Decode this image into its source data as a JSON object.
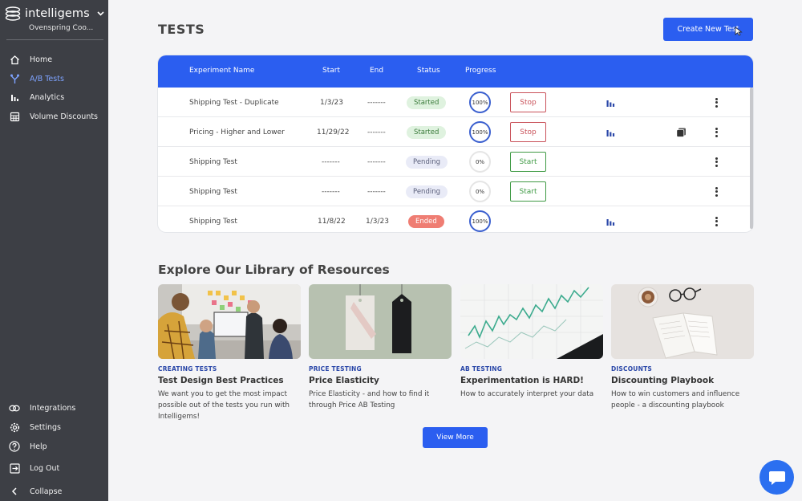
{
  "sidebar": {
    "brand": "intelligems",
    "store": "Ovenspring Coo...",
    "top_items": [
      {
        "label": "Home",
        "icon": "home-icon"
      },
      {
        "label": "A/B Tests",
        "icon": "fork-icon",
        "active": true
      },
      {
        "label": "Analytics",
        "icon": "bar-chart-icon"
      },
      {
        "label": "Volume Discounts",
        "icon": "calculator-icon"
      }
    ],
    "bottom_items": [
      {
        "label": "Integrations",
        "icon": "link-icon"
      },
      {
        "label": "Settings",
        "icon": "gear-icon"
      },
      {
        "label": "Help",
        "icon": "help-icon"
      },
      {
        "label": "Log Out",
        "icon": "logout-icon"
      },
      {
        "label": "Collapse",
        "icon": "chevron-left-icon"
      }
    ]
  },
  "header": {
    "title": "TESTS",
    "create_label": "Create New Test"
  },
  "table": {
    "columns": {
      "name": "Experiment Name",
      "start": "Start",
      "end": "End",
      "status": "Status",
      "progress": "Progress"
    },
    "rows": [
      {
        "name": "Shipping Test - Duplicate",
        "start": "1/3/23",
        "end": "-------",
        "status": "Started",
        "progress": "100%",
        "action": "Stop",
        "chart": true,
        "copy": false
      },
      {
        "name": "Pricing - Higher and Lower",
        "start": "11/29/22",
        "end": "-------",
        "status": "Started",
        "progress": "100%",
        "action": "Stop",
        "chart": true,
        "copy": true
      },
      {
        "name": "Shipping Test",
        "start": "-------",
        "end": "-------",
        "status": "Pending",
        "progress": "0%",
        "action": "Start",
        "chart": false,
        "copy": false
      },
      {
        "name": "Shipping Test",
        "start": "-------",
        "end": "-------",
        "status": "Pending",
        "progress": "0%",
        "action": "Start",
        "chart": false,
        "copy": false
      },
      {
        "name": "Shipping Test",
        "start": "11/8/22",
        "end": "1/3/23",
        "status": "Ended",
        "progress": "100%",
        "action": "",
        "chart": true,
        "copy": false
      }
    ]
  },
  "resources": {
    "title": "Explore Our Library of Resources",
    "cards": [
      {
        "category": "CREATING TESTS",
        "title": "Test Design Best Practices",
        "desc": "We want you to get the most impact possible out of the tests you run with Intelligems!"
      },
      {
        "category": "PRICE TESTING",
        "title": "Price Elasticity",
        "desc": "Price Elasticity - and how to find it through Price AB Testing"
      },
      {
        "category": "AB TESTING",
        "title": "Experimentation is HARD!",
        "desc": "How to accurately interpret your data"
      },
      {
        "category": "DISCOUNTS",
        "title": "Discounting Playbook",
        "desc": "How to win customers and influence people - a discounting playbook"
      }
    ],
    "view_more_label": "View More"
  },
  "colors": {
    "accent": "#2b5ef0",
    "sidebar": "#3d3f45",
    "stop": "#c9525a",
    "start": "#3f9a44",
    "ended": "#ef7d73"
  }
}
